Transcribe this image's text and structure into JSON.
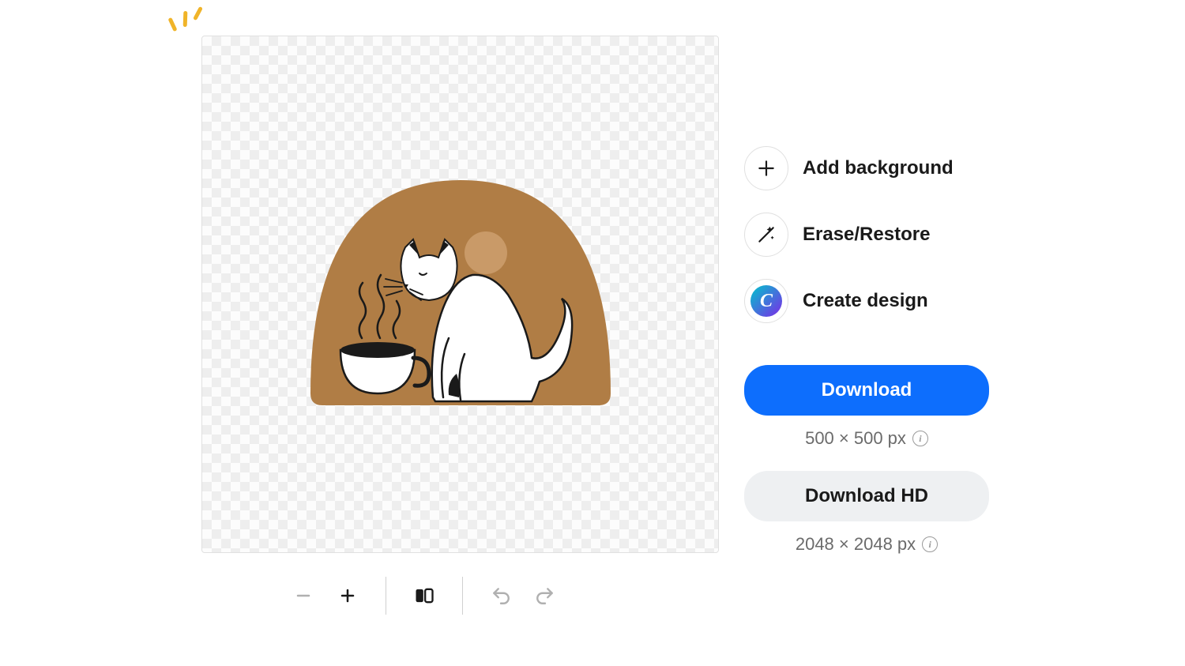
{
  "actions": {
    "add_background": "Add background",
    "erase_restore": "Erase/Restore",
    "create_design": "Create design",
    "canva_letter": "C"
  },
  "download": {
    "primary_label": "Download",
    "primary_size": "500 × 500 px",
    "hd_label": "Download HD",
    "hd_size": "2048 × 2048 px"
  },
  "illustration": {
    "description": "white cat with coffee cup on brown arch background"
  }
}
